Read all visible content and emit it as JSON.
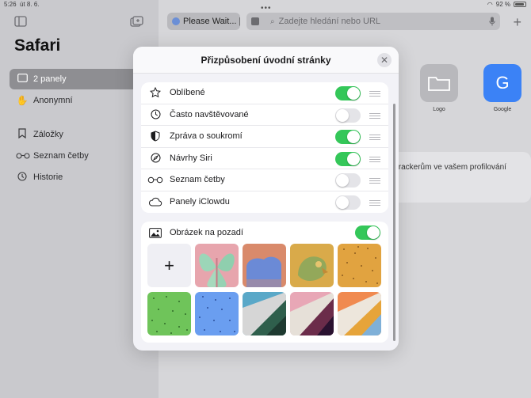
{
  "status": {
    "time": "5:26",
    "date": "út 8. 6.",
    "battery": "92 %"
  },
  "sidebar": {
    "title": "Safari",
    "items": [
      {
        "label": "2 panely",
        "icon": "tabs-icon",
        "active": true
      },
      {
        "label": "Anonymní",
        "icon": "hand-icon",
        "active": false
      },
      {
        "label": "Záložky",
        "icon": "bookmark-icon",
        "active": false
      },
      {
        "label": "Seznam četby",
        "icon": "glasses-icon",
        "active": false
      },
      {
        "label": "Historie",
        "icon": "clock-icon",
        "active": false
      }
    ]
  },
  "main": {
    "tab_label": "Please Wait... |",
    "url_placeholder": "Zadejte hledání nebo URL",
    "favorites": [
      {
        "label": "Logo",
        "color": "#b8b8bc"
      },
      {
        "label": "Google",
        "color": "#3b82f6",
        "glyph": "G"
      }
    ],
    "privacy_snippet": "trackerům ve vašem profilování"
  },
  "modal": {
    "title": "Přizpůsobení úvodní stránky",
    "sections": [
      {
        "label": "Oblíbené",
        "icon": "star-icon",
        "enabled": true
      },
      {
        "label": "Často navštěvované",
        "icon": "clock-icon",
        "enabled": false
      },
      {
        "label": "Zpráva o soukromí",
        "icon": "shield-icon",
        "enabled": true
      },
      {
        "label": "Návrhy Siri",
        "icon": "compass-icon",
        "enabled": true
      },
      {
        "label": "Seznam četby",
        "icon": "glasses-icon",
        "enabled": false
      },
      {
        "label": "Panely iClowdu",
        "icon": "cloud-icon",
        "enabled": false
      }
    ],
    "background": {
      "label": "Obrázek na pozadí",
      "enabled": true
    },
    "wallpapers": [
      "add",
      "butterfly",
      "bear",
      "parrot",
      "orange-dots",
      "green-dots",
      "blue-dots",
      "folds-green",
      "folds-purple",
      "folds-orange"
    ]
  },
  "colors": {
    "accent_green": "#34c759",
    "sidebar_active": "#8e8e92"
  }
}
